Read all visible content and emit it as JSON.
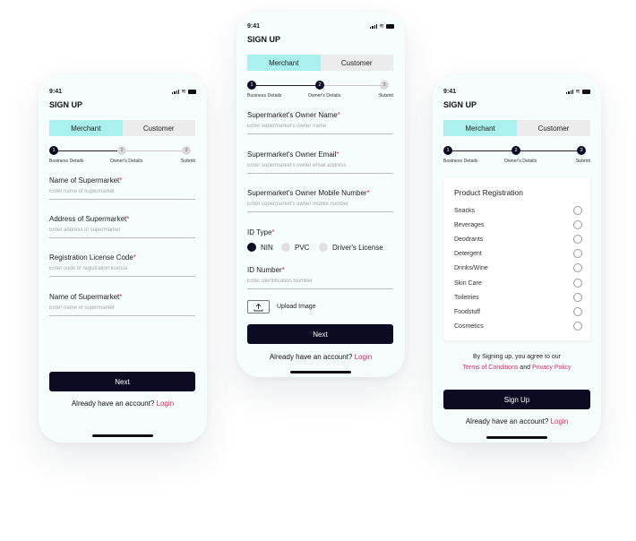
{
  "status": {
    "time": "9:41",
    "wifi_icon": "wifi-icon",
    "battery_icon": "battery-icon"
  },
  "colors": {
    "accent_tab": "#a9f0ef",
    "primary_button": "#0b0c24",
    "link": "#e0245e"
  },
  "screen1": {
    "title": "SIGN UP",
    "tabs": [
      "Merchant",
      "Customer"
    ],
    "steps": [
      {
        "num": "1",
        "label": "Business Details"
      },
      {
        "num": "2",
        "label": "Owner's Details"
      },
      {
        "num": "3",
        "label": "Submit"
      }
    ],
    "fields": [
      {
        "label": "Name of Supermarket",
        "required": "*",
        "placeholder": "Enter name of supermarket"
      },
      {
        "label": "Address of Supermarket",
        "required": "*",
        "placeholder": "Enter address of supermarket"
      },
      {
        "label": "Registration License Code",
        "required": "*",
        "placeholder": "Enter code of registration  license"
      },
      {
        "label": "Name of Supermarket",
        "required": "*",
        "placeholder": "Enter name of supermarket"
      }
    ],
    "button": "Next",
    "footer_text": "Already have an  account?",
    "footer_link": "Login"
  },
  "screen2": {
    "title": "SIGN UP",
    "tabs": [
      "Merchant",
      "Customer"
    ],
    "steps": [
      {
        "num": "1",
        "label": "Business Details"
      },
      {
        "num": "2",
        "label": "Owner's Details"
      },
      {
        "num": "3",
        "label": "Submit"
      }
    ],
    "fields": [
      {
        "label": "Supermarket's Owner Name",
        "required": "*",
        "placeholder": "Enter supermarket's owner name"
      },
      {
        "label": "Supermarket's Owner Email",
        "required": "*",
        "placeholder": "Enter supermarket's owner email address"
      },
      {
        "label": "Supermarket's Owner Mobile Number",
        "required": "*",
        "placeholder": "Enter supermarket's owner mobile number"
      }
    ],
    "id_type": {
      "label": "ID Type",
      "required": "*",
      "options": [
        "NIN",
        "PVC",
        "Driver's License"
      ],
      "selected": "NIN"
    },
    "id_number": {
      "label": "ID Number",
      "required": "*",
      "placeholder": "Enter Identification Number"
    },
    "upload_label": "Upload Image",
    "button": "Next",
    "footer_text": "Already have an  account?",
    "footer_link": "Login"
  },
  "screen3": {
    "title": "SIGN UP",
    "tabs": [
      "Merchant",
      "Customer"
    ],
    "steps": [
      {
        "num": "1",
        "label": "Business Details"
      },
      {
        "num": "2",
        "label": "Owner's Details"
      },
      {
        "num": "3",
        "label": "Submit"
      }
    ],
    "product_title": "Product Registration",
    "products": [
      "Snacks",
      "Beverages",
      "Deodrants",
      "Detergent",
      "Drinks/Wine",
      "Skin Care",
      "Toiletries",
      "Foodstuff",
      "Cosmetics"
    ],
    "terms_line1": "By Signing up, you agree to our",
    "terms_link1": "Terms of Conditions",
    "terms_and": "and",
    "terms_link2": "Privacy Policy",
    "button": "Sign Up",
    "footer_text": "Already have an  account?",
    "footer_link": "Login"
  }
}
